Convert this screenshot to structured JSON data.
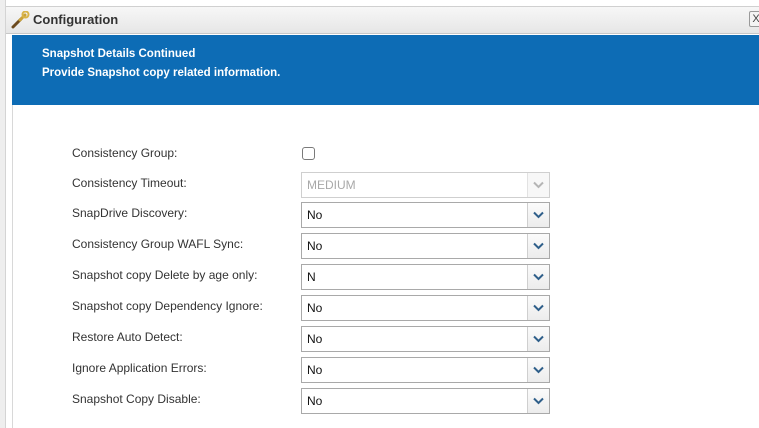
{
  "window": {
    "title": "Configuration",
    "close_label": "X",
    "title_icon": "wrench-icon"
  },
  "banner": {
    "title": "Snapshot Details Continued",
    "subtitle": "Provide Snapshot copy related information."
  },
  "form": {
    "consistency_group": {
      "label": "Consistency Group:",
      "checked": false
    },
    "consistency_timeout": {
      "label": "Consistency Timeout:",
      "value": "MEDIUM",
      "disabled": true
    },
    "snapdrive_discovery": {
      "label": "SnapDrive Discovery:",
      "value": "No"
    },
    "wafl_sync": {
      "label": "Consistency Group WAFL Sync:",
      "value": "No"
    },
    "delete_by_age": {
      "label": "Snapshot copy Delete by age only:",
      "value": "N"
    },
    "dependency_ignore": {
      "label": "Snapshot copy Dependency Ignore:",
      "value": "No"
    },
    "restore_auto_detect": {
      "label": "Restore Auto Detect:",
      "value": "No"
    },
    "ignore_app_errors": {
      "label": "Ignore Application Errors:",
      "value": "No"
    },
    "snapshot_copy_disable": {
      "label": "Snapshot Copy Disable:",
      "value": "No"
    }
  },
  "colors": {
    "banner_bg": "#0d6cb5",
    "banner_text": "#ffffff",
    "label_text": "#333333",
    "disabled_text": "#a8a8a8"
  }
}
